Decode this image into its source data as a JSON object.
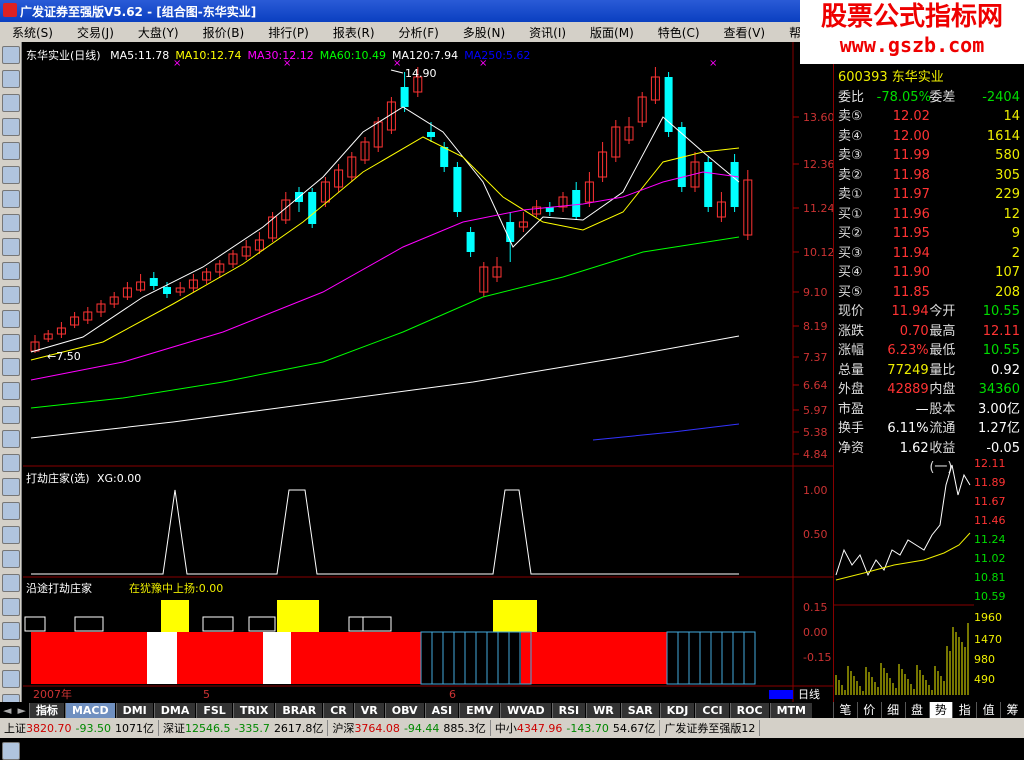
{
  "window": {
    "title": "广发证券至强版V5.62 - [组合图-东华实业]"
  },
  "watermark": {
    "line1": "股票公式指标网",
    "line2": "www.gszb.com"
  },
  "menu": [
    "系统(S)",
    "交易(J)",
    "大盘(Y)",
    "报价(B)",
    "排行(P)",
    "报表(R)",
    "分析(F)",
    "多股(N)",
    "资讯(I)",
    "版面(M)",
    "特色(C)",
    "查看(V)",
    "帮助(H)"
  ],
  "main_chart": {
    "name": "东华实业(日线)",
    "ma": [
      {
        "label": "MA5:11.78",
        "color": "#ffffff"
      },
      {
        "label": "MA10:12.74",
        "color": "#ffff00"
      },
      {
        "label": "MA30:12.12",
        "color": "#ff00ff"
      },
      {
        "label": "MA60:10.49",
        "color": "#00ff00"
      },
      {
        "label": "MA120:7.94",
        "color": "#ffffff"
      },
      {
        "label": "MA250:5.62",
        "color": "#0000ff"
      }
    ],
    "y_ticks": [
      "13.60",
      "12.36",
      "11.24",
      "10.12",
      "9.10",
      "8.19",
      "7.37",
      "6.64",
      "5.97",
      "5.38",
      "4.84"
    ],
    "high_label": "14.90",
    "low_label": "7.50"
  },
  "indicator1": {
    "title": "打劫庄家(选)",
    "value_label": "XG:0.00",
    "y_ticks": [
      "1.00",
      "0.50"
    ]
  },
  "indicator2": {
    "title": "沿途打劫庄家",
    "signal_label": "在犹豫中上扬:0.00",
    "y_ticks": [
      "0.15",
      "0.00",
      "-0.15"
    ]
  },
  "timeline": {
    "labels": [
      "2007年",
      "5",
      "6"
    ],
    "period": "日线"
  },
  "bottom_tabs": [
    "指标",
    "MACD",
    "DMI",
    "DMA",
    "FSL",
    "TRIX",
    "BRAR",
    "CR",
    "VR",
    "OBV",
    "ASI",
    "EMV",
    "WVAD",
    "RSI",
    "WR",
    "SAR",
    "KDJ",
    "CCI",
    "ROC",
    "MTM"
  ],
  "right_tabs": [
    "笔",
    "价",
    "细",
    "盘",
    "势",
    "指",
    "值",
    "筹"
  ],
  "quote": {
    "code_partial": "600393 东华实业",
    "weibi": {
      "label": "委比",
      "value": "-78.05%",
      "label2": "委差",
      "value2": "-2404"
    },
    "sell": [
      {
        "label": "卖⑤",
        "price": "12.02",
        "vol": "14"
      },
      {
        "label": "卖④",
        "price": "12.00",
        "vol": "1614"
      },
      {
        "label": "卖③",
        "price": "11.99",
        "vol": "580"
      },
      {
        "label": "卖②",
        "price": "11.98",
        "vol": "305"
      },
      {
        "label": "卖①",
        "price": "11.97",
        "vol": "229"
      }
    ],
    "buy": [
      {
        "label": "买①",
        "price": "11.96",
        "vol": "12"
      },
      {
        "label": "买②",
        "price": "11.95",
        "vol": "9"
      },
      {
        "label": "买③",
        "price": "11.94",
        "vol": "2"
      },
      {
        "label": "买④",
        "price": "11.90",
        "vol": "107"
      },
      {
        "label": "买⑤",
        "price": "11.85",
        "vol": "208"
      }
    ],
    "stats": [
      {
        "l1": "现价",
        "v1": "11.94",
        "c1": "red",
        "l2": "今开",
        "v2": "10.55",
        "c2": "green"
      },
      {
        "l1": "涨跌",
        "v1": "0.70",
        "c1": "red",
        "l2": "最高",
        "v2": "12.11",
        "c2": "red"
      },
      {
        "l1": "涨幅",
        "v1": "6.23%",
        "c1": "red",
        "l2": "最低",
        "v2": "10.55",
        "c2": "green"
      },
      {
        "l1": "总量",
        "v1": "77249",
        "c1": "yellow",
        "l2": "量比",
        "v2": "0.92",
        "c2": "white"
      },
      {
        "l1": "外盘",
        "v1": "42889",
        "c1": "red",
        "l2": "内盘",
        "v2": "34360",
        "c2": "green"
      }
    ],
    "fund": [
      {
        "l1": "市盈",
        "v1": "—",
        "l2": "股本",
        "v2": "3.00亿"
      },
      {
        "l1": "换手",
        "v1": "6.11%",
        "l2": "流通",
        "v2": "1.27亿"
      },
      {
        "l1": "净资",
        "v1": "1.62",
        "l2": "收益(一)",
        "v2": "-0.05"
      }
    ]
  },
  "intraday": {
    "price_ticks": [
      "12.11",
      "11.89",
      "11.67",
      "11.46",
      "11.24",
      "11.02",
      "10.81",
      "10.59"
    ],
    "volume_ticks": [
      "1960",
      "1470",
      "980",
      "490"
    ]
  },
  "status": [
    {
      "name": "上证",
      "value": "3820.70",
      "change": "-93.50",
      "amount": "1071亿",
      "color": "red"
    },
    {
      "name": "深证",
      "value": "12546.5",
      "change": "-335.7",
      "amount": "2617.8亿",
      "color": "green"
    },
    {
      "name": "沪深",
      "value": "3764.08",
      "change": "-94.44",
      "amount": "885.3亿",
      "color": "red"
    },
    {
      "name": "中小",
      "value": "4347.96",
      "change": "-143.70",
      "amount": "54.67亿",
      "color": "red"
    }
  ],
  "status_app": "广发证券至强版12"
}
